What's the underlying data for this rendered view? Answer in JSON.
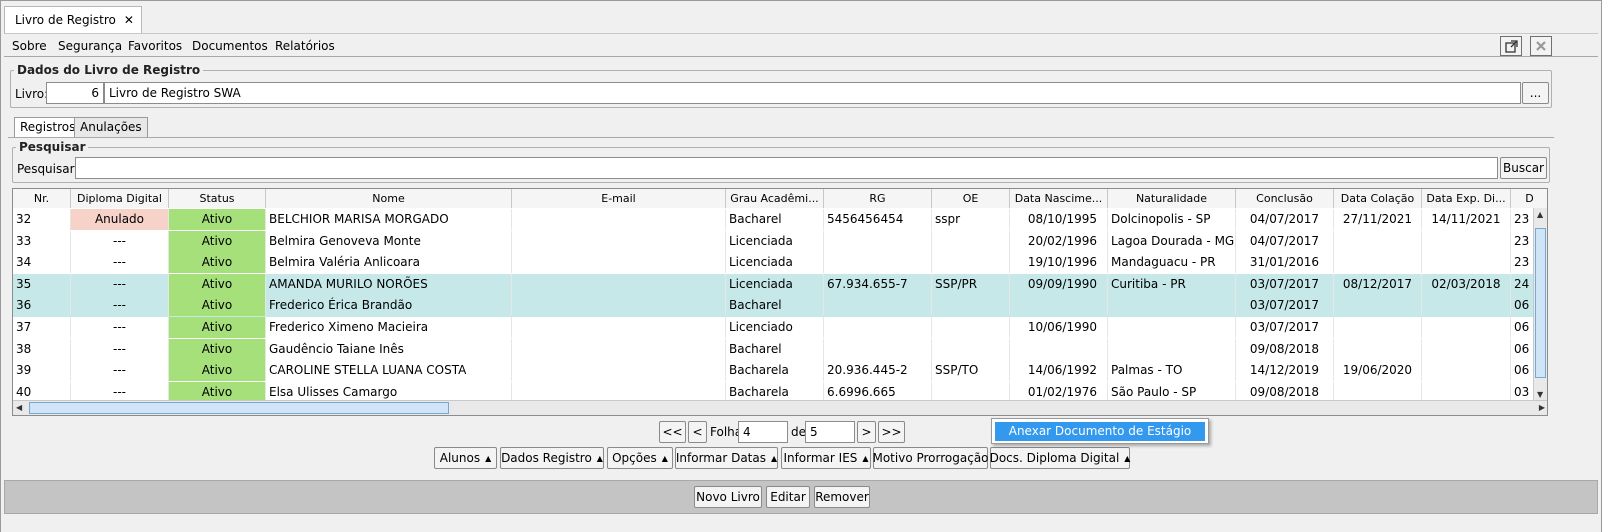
{
  "tab": {
    "title": "Livro de Registro",
    "close": "✕"
  },
  "menu": [
    {
      "label": "Sobre"
    },
    {
      "label": "Segurança"
    },
    {
      "label": "Favoritos"
    },
    {
      "label": "Documentos"
    },
    {
      "label": "Relatórios"
    }
  ],
  "dados": {
    "title": "Dados do Livro de Registro",
    "livro_label": "Livro:",
    "livro_num": "6",
    "livro_nome": "Livro de Registro SWA",
    "browse": "..."
  },
  "tabs": [
    {
      "label": "Registros"
    },
    {
      "label": "Anulações"
    }
  ],
  "search": {
    "title": "Pesquisar",
    "label": "Pesquisar:",
    "value": "",
    "button": "Buscar"
  },
  "table": {
    "headers": [
      "Nr.",
      "Diploma Digital",
      "Status",
      "Nome",
      "E-mail",
      "Grau Acadêmi...",
      "RG",
      "OE",
      "Data Nascime...",
      "Naturalidade",
      "Conclusão",
      "Data Colação",
      "Data Exp. Di...",
      "D"
    ],
    "rows": [
      {
        "nr": "32",
        "diploma": "Anulado",
        "status": "Ativo",
        "nome": "BELCHIOR MARISA MORGADO",
        "email": "",
        "grau": "Bacharel",
        "rg": "5456456454",
        "oe": "sspr",
        "nasc": "08/10/1995",
        "nat": "Dolcinopolis - SP",
        "concl": "04/07/2017",
        "colacao": "27/11/2021",
        "exp": "14/11/2021",
        "d": "23"
      },
      {
        "nr": "33",
        "diploma": "---",
        "status": "Ativo",
        "nome": "Belmira Genoveva Monte",
        "email": "",
        "grau": "Licenciada",
        "rg": "",
        "oe": "",
        "nasc": "20/02/1996",
        "nat": "Lagoa Dourada - MG",
        "concl": "04/07/2017",
        "colacao": "",
        "exp": "",
        "d": "23"
      },
      {
        "nr": "34",
        "diploma": "---",
        "status": "Ativo",
        "nome": "Belmira Valéria Anlicoara",
        "email": "",
        "grau": "Licenciada",
        "rg": "",
        "oe": "",
        "nasc": "19/10/1996",
        "nat": "Mandaguacu - PR",
        "concl": "31/01/2016",
        "colacao": "",
        "exp": "",
        "d": "23"
      },
      {
        "nr": "35",
        "diploma": "---",
        "status": "Ativo",
        "nome": "AMANDA MURILO NORÕES",
        "email": "",
        "grau": "Licenciada",
        "rg": "67.934.655-7",
        "oe": "SSP/PR",
        "nasc": "09/09/1990",
        "nat": "Curitiba - PR",
        "concl": "03/07/2017",
        "colacao": "08/12/2017",
        "exp": "02/03/2018",
        "d": "24"
      },
      {
        "nr": "36",
        "diploma": "---",
        "status": "Ativo",
        "nome": "Frederico Érica Brandão",
        "email": "",
        "grau": "Bacharel",
        "rg": "",
        "oe": "",
        "nasc": "",
        "nat": "",
        "concl": "03/07/2017",
        "colacao": "",
        "exp": "",
        "d": "06"
      },
      {
        "nr": "37",
        "diploma": "---",
        "status": "Ativo",
        "nome": "Frederico Ximeno Macieira",
        "email": "",
        "grau": "Licenciado",
        "rg": "",
        "oe": "",
        "nasc": "10/06/1990",
        "nat": "",
        "concl": "03/07/2017",
        "colacao": "",
        "exp": "",
        "d": "06"
      },
      {
        "nr": "38",
        "diploma": "---",
        "status": "Ativo",
        "nome": "Gaudêncio Taiane Inês",
        "email": "",
        "grau": "Bacharel",
        "rg": "",
        "oe": "",
        "nasc": "",
        "nat": "",
        "concl": "09/08/2018",
        "colacao": "",
        "exp": "",
        "d": "06"
      },
      {
        "nr": "39",
        "diploma": "---",
        "status": "Ativo",
        "nome": "CAROLINE STELLA LUANA COSTA",
        "email": "",
        "grau": "Bacharela",
        "rg": "20.936.445-2",
        "oe": "SSP/TO",
        "nasc": "14/06/1992",
        "nat": "Palmas - TO",
        "concl": "14/12/2019",
        "colacao": "19/06/2020",
        "exp": "",
        "d": "06"
      },
      {
        "nr": "40",
        "diploma": "---",
        "status": "Ativo",
        "nome": "Elsa Ulisses Camargo",
        "email": "",
        "grau": "Bacharela",
        "rg": "6.6996.665",
        "oe": "",
        "nasc": "01/02/1976",
        "nat": "São Paulo - SP",
        "concl": "09/08/2018",
        "colacao": "",
        "exp": "",
        "d": "03"
      }
    ]
  },
  "pager": {
    "first": "<<",
    "prev": "<",
    "label": "Folha",
    "page": "4",
    "of": "de",
    "total": "5",
    "next": ">",
    "last": ">>"
  },
  "popup": {
    "item": "Anexar Documento de Estágio"
  },
  "actions": [
    {
      "label": "Alunos",
      "arrow": "▲"
    },
    {
      "label": "Dados Registro",
      "arrow": "▲"
    },
    {
      "label": "Opções",
      "arrow": "▲"
    },
    {
      "label": "Informar Datas",
      "arrow": "▲"
    },
    {
      "label": "Informar IES",
      "arrow": "▲"
    },
    {
      "label": "Motivo Prorrogação",
      "arrow": ""
    },
    {
      "label": "Docs. Diploma Digital",
      "arrow": "▲"
    }
  ],
  "bottom": {
    "novo": "Novo Livro",
    "editar": "Editar",
    "remover": "Remover"
  }
}
